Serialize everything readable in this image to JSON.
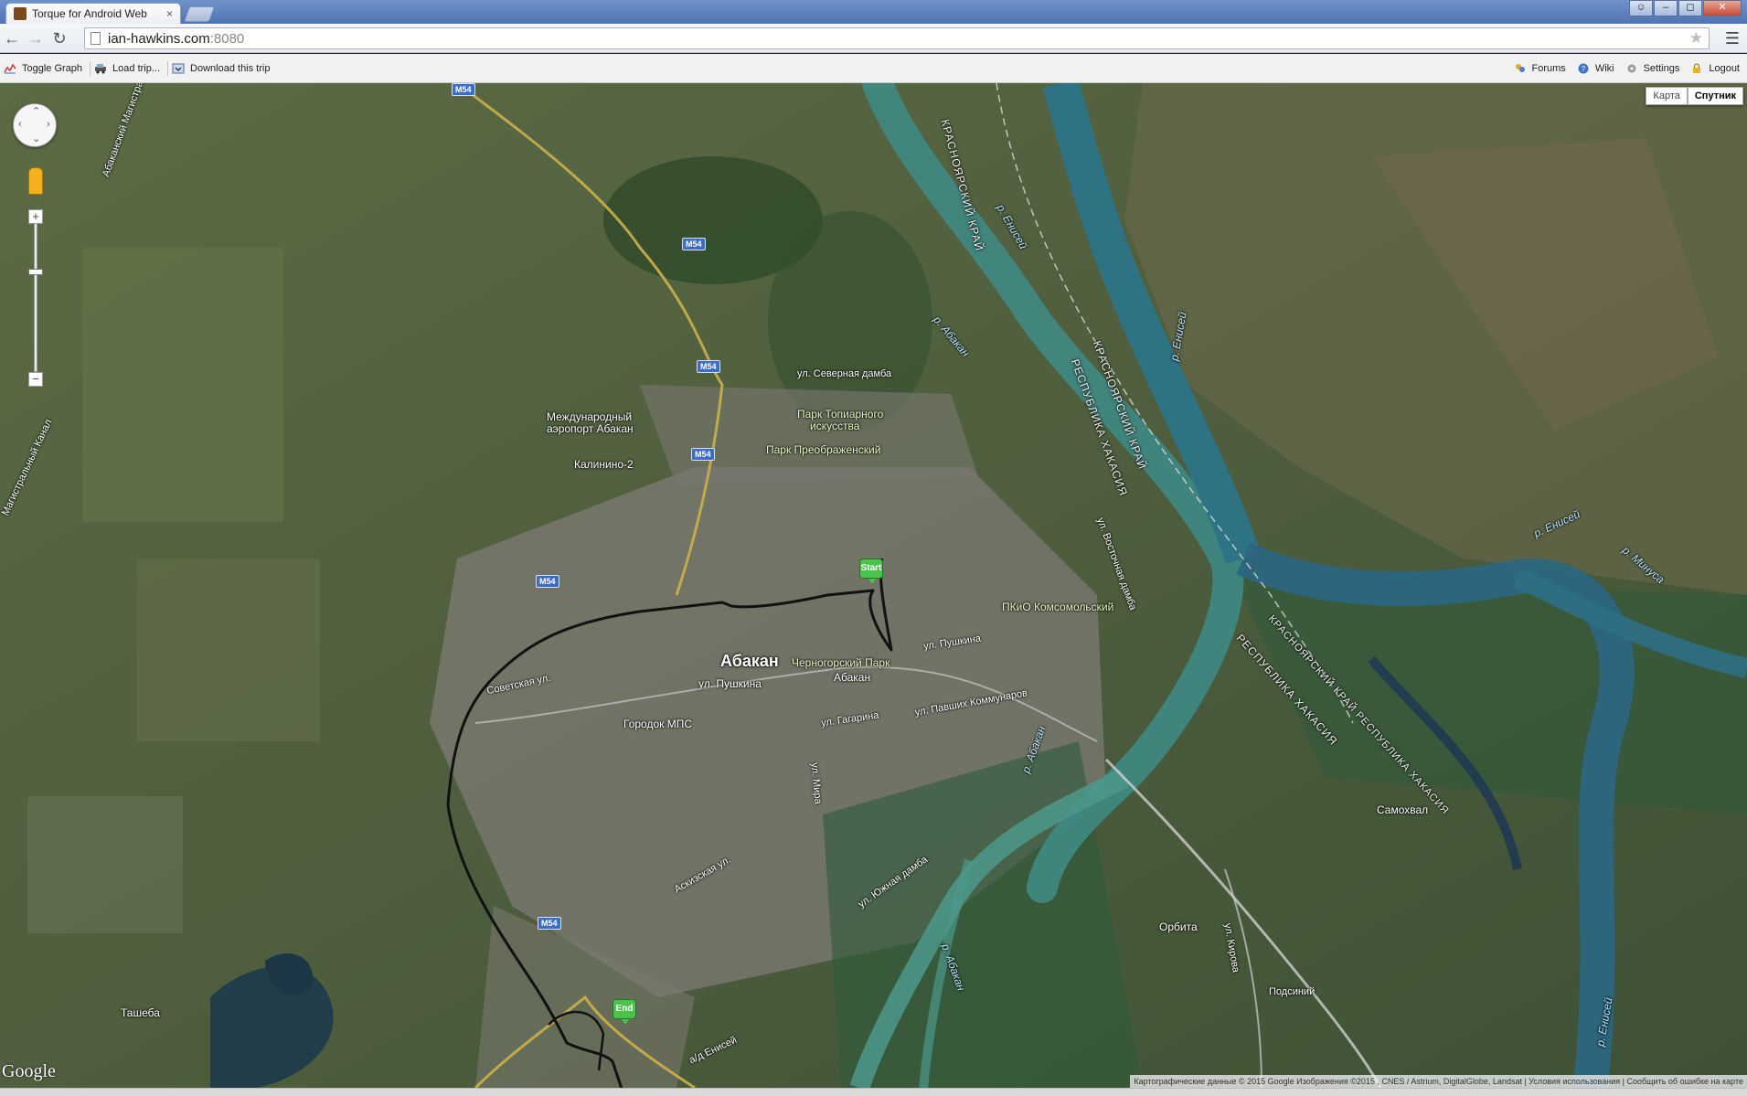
{
  "browser": {
    "tab_title": "Torque for Android Web ",
    "tab_close": "×",
    "url_host": "ian-hawkins.com",
    "url_port": ":8080"
  },
  "toolbar": {
    "toggle_graph": "Toggle Graph",
    "load_trip": "Load trip...",
    "download_trip": "Download this trip",
    "forums": "Forums",
    "wiki": "Wiki",
    "settings": "Settings",
    "logout": "Logout"
  },
  "map": {
    "maptype_map": "Карта",
    "maptype_satellite": "Спутник",
    "markers": {
      "start": "Start",
      "end": "End"
    },
    "labels": {
      "city": "Абакан",
      "airport_1": "Международный",
      "airport_2": "аэропорт Абакан",
      "kalinino": "Калинино-2",
      "severnaya": "ул. Северная дамба",
      "park_topiar_1": "Парк Топиарного",
      "park_topiar_2": "искусства",
      "park_preobr": "Парк Преображенский",
      "chernogorsky": "Черногорский Парк",
      "abakan_station": "Абакан",
      "sovetskaya": "Советская ул.",
      "pushkina_1": "ул. Пушкина",
      "pushkina_2": "ул. Пушкина",
      "gorodok": "Городок МПС",
      "gagarina": "ул. Гагарина",
      "pavshikh": "ул. Павших Коммунаров",
      "komsomolsky": "ПКиО Комсомольский",
      "samokhval": "Самохвал",
      "orbita": "Орбита",
      "podsiny": "Подсиний",
      "tasheba": "Ташеба",
      "askizskaya": "Аскизская ул.",
      "yuzhnaya": "ул. Южная дамба",
      "mira": "ул. Мира",
      "vostochnaya": "ул. Восточная дамба",
      "kirova": "ул. Кирова",
      "enisey_1": "р. Енисей",
      "enisey_2": "р. Енисей",
      "enisey_3": "р. Енисей",
      "enisey_4": "р. Енисей",
      "abakan_river_1": "р. Абакан",
      "abakan_river_2": "р. Абакан",
      "abakan_river_3": "р. Абакан",
      "minusa": "р. Минуса",
      "krai_1": "КРАСНОЯРСКИЙ КРАЙ",
      "krai_2": "КРАСНОЯРСКИЙ КРАЙ",
      "khakasia_1": "РЕСПУБЛИКА ХАКАСИЯ",
      "khakasia_2": "РЕСПУБЛИКА ХАКАСИЯ",
      "krai_khakasia": "КРАСНОЯРСКИЙ КРАЙ   РЕСПУБЛИКА ХАКАСИЯ",
      "d_enisey": "а/д Енисей",
      "canal_1": "Абаканский Магистральный Канал",
      "canal_2": "Магистральный Канал",
      "m54": "M54"
    },
    "google": "Google",
    "attribution": "Картографические данные © 2015 Google Изображения ©2015 , CNES / Astrium, DigitalGlobe, Landsat | Условия использования | Сообщить об ошибке на карте"
  },
  "colors": {
    "route": "#111111",
    "water": "#3f8a84",
    "marker": "#4bc24b"
  }
}
